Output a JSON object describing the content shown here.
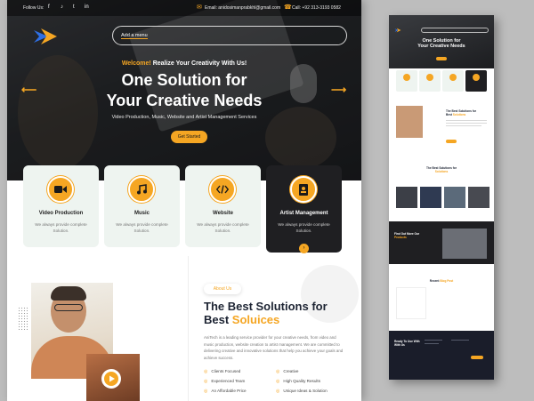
{
  "topbar": {
    "follow_label": "Follow Us:",
    "social_icons": [
      "facebook-icon",
      "tiktok-icon",
      "twitter-icon",
      "linkedin-icon"
    ],
    "email_text": "Email: anidosimanprabkhl@gmail.com",
    "phone_text": "Call: +92 313-3193 0582"
  },
  "menu": {
    "label": "Add a menu"
  },
  "hero": {
    "welcome_highlight": "Welcome!",
    "welcome_rest": " Realize Your Creativity With Us!",
    "headline_line1": "One Solution for",
    "headline_line2": "Your Creative Needs",
    "subline": "Video Production, Music, Website and Artist Management Services",
    "cta_label": "Get Started",
    "prev_arrow": "⟵",
    "next_arrow": "⟶"
  },
  "services": [
    {
      "title": "Video Production",
      "desc": "We always provide complete Solution.",
      "icon": "video-camera-icon"
    },
    {
      "title": "Music",
      "desc": "We always provide complete Solution.",
      "icon": "music-note-icon"
    },
    {
      "title": "Website",
      "desc": "We always provide complete Solution.",
      "icon": "code-icon"
    },
    {
      "title": "Artist Management",
      "desc": "We always provide complete Solution.",
      "icon": "artist-badge-icon",
      "active": true
    }
  ],
  "service_next": "›",
  "about": {
    "badge": "About Us",
    "title_line1": "The Best Solutions for",
    "title_prefix": "Best ",
    "title_highlight": "Soluices",
    "body": "AniTech is a leading service provider for your creative needs, from video and music production, website creation to artist management. We are committed to delivering creative and innovative solutions that help you achieve your goals and achieve success.",
    "features": [
      "Clients Focused",
      "Creative",
      "Experienced Team",
      "High Quality Results",
      "An Affordable Price",
      "Unique Ideas & Solution"
    ],
    "tick": "◎"
  },
  "thumbnail": {
    "hero_title_1": "One Solution for",
    "hero_title_2": "Your Creative Needs",
    "about_title_1": "The Best Solutions for",
    "about_title_prefix": "Best ",
    "about_title_highlight": "Solutions",
    "solutions_title_1": "The Best Solutions for",
    "solutions_title_highlight": "Solutions",
    "work_title_1": "Find Out More Our",
    "work_title_highlight": "Products",
    "blog_title_prefix": "Recent ",
    "blog_title_highlight": "Blog Post",
    "footer_title_1": "Ready To Use With",
    "footer_title_2": "With Us"
  },
  "colors": {
    "accent": "#f5a623",
    "dark": "#1f1f22",
    "card": "#eef4f0",
    "heading": "#1d2433"
  }
}
